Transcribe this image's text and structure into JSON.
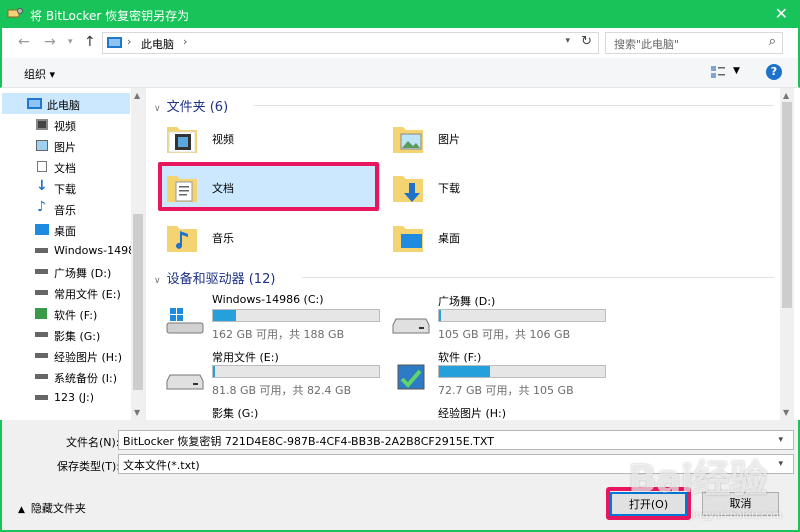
{
  "window": {
    "title": "将 BitLocker 恢复密钥另存为",
    "close_glyph": "✕"
  },
  "address": {
    "path": "此电脑",
    "search_placeholder": "搜索\"此电脑\""
  },
  "toolbar": {
    "organize_label": "组织 ▾",
    "help_label": "?"
  },
  "sidebar": {
    "items": [
      {
        "label": "此电脑",
        "icon": "computer-icon",
        "selected": true
      },
      {
        "label": "视频",
        "icon": "video-icon"
      },
      {
        "label": "图片",
        "icon": "picture-icon"
      },
      {
        "label": "文档",
        "icon": "document-icon"
      },
      {
        "label": "下载",
        "icon": "download-icon"
      },
      {
        "label": "音乐",
        "icon": "music-icon"
      },
      {
        "label": "桌面",
        "icon": "desktop-icon"
      },
      {
        "label": "Windows-1498",
        "icon": "drive-icon"
      },
      {
        "label": "广场舞 (D:)",
        "icon": "drive-icon"
      },
      {
        "label": "常用文件 (E:)",
        "icon": "drive-icon"
      },
      {
        "label": "软件 (F:)",
        "icon": "drive-icon"
      },
      {
        "label": "影集 (G:)",
        "icon": "drive-icon"
      },
      {
        "label": "经验图片 (H:)",
        "icon": "drive-icon"
      },
      {
        "label": "系统备份 (I:)",
        "icon": "drive-icon"
      },
      {
        "label": "123 (J:)",
        "icon": "drive-icon"
      }
    ]
  },
  "folders": {
    "header": "文件夹 (6)",
    "items": [
      {
        "label": "视频",
        "overlay": "video"
      },
      {
        "label": "图片",
        "overlay": "picture"
      },
      {
        "label": "文档",
        "overlay": "document",
        "selected": true
      },
      {
        "label": "下载",
        "overlay": "download"
      },
      {
        "label": "音乐",
        "overlay": "music"
      },
      {
        "label": "桌面",
        "overlay": "desktop"
      }
    ]
  },
  "devices": {
    "header": "设备和驱动器 (12)",
    "items": [
      {
        "name": "Windows-14986 (C:)",
        "size": "162 GB 可用，共 188 GB",
        "used_fraction": 0.14,
        "icon": "windows-drive-icon"
      },
      {
        "name": "广场舞 (D:)",
        "size": "105 GB 可用，共 106 GB",
        "used_fraction": 0.01,
        "icon": "hdd-icon"
      },
      {
        "name": "常用文件 (E:)",
        "size": "81.8 GB 可用，共 82.4 GB",
        "used_fraction": 0.01,
        "icon": "hdd-icon"
      },
      {
        "name": "软件 (F:)",
        "size": "72.7 GB 可用，共 105 GB",
        "used_fraction": 0.31,
        "icon": "software-drive-icon"
      },
      {
        "name": "影集 (G:)",
        "size": "",
        "used_fraction": 0.0,
        "icon": "hdd-icon"
      },
      {
        "name": "经验图片 (H:)",
        "size": "",
        "used_fraction": 0.0,
        "icon": "hdd-icon"
      }
    ]
  },
  "form": {
    "filename_label": "文件名(N):",
    "filename_value": "BitLocker 恢复密钥 721D4E8C-987B-4CF4-BB3B-2A2B8CF2915E.TXT",
    "filetype_label": "保存类型(T):",
    "filetype_value": "文本文件(*.txt)",
    "hide_folders_label": "隐藏文件夹",
    "open_button": "打开(O)",
    "cancel_button": "取消"
  },
  "watermark": {
    "text": "Bai经验",
    "sub": "jingyan.baidu.com"
  },
  "colors": {
    "title_bar": "#18c35a",
    "selection": "#cce8ff",
    "highlight_box": "#e8175d",
    "drive_bar": "#26a0da"
  }
}
